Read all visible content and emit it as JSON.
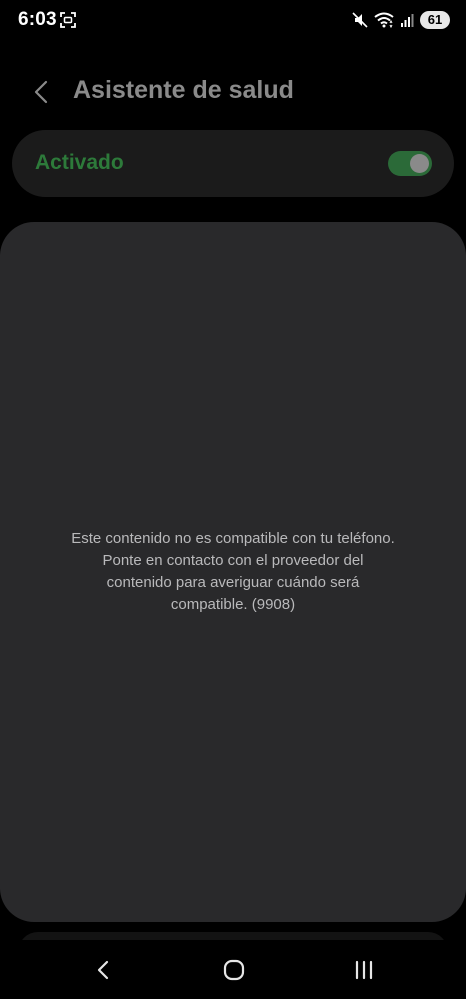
{
  "status_bar": {
    "time": "6:03",
    "battery_level": "61",
    "icons": [
      "screenshot-icon",
      "mute-icon",
      "wifi-icon",
      "signal-icon",
      "battery-icon"
    ]
  },
  "header": {
    "title": "Asistente de salud",
    "back_icon": "chevron-left-icon"
  },
  "master_switch": {
    "label": "Activado",
    "state": "on",
    "label_color": "#2d7a3a",
    "track_color": "#2b6a38"
  },
  "content": {
    "message": "Este contenido no es compatible con tu teléfono. Ponte en contacto con el proveedor del contenido para averiguar cuándo será compatible. (9908)"
  },
  "nav_bar": {
    "buttons": [
      "back-icon",
      "home-icon",
      "recents-icon"
    ]
  }
}
